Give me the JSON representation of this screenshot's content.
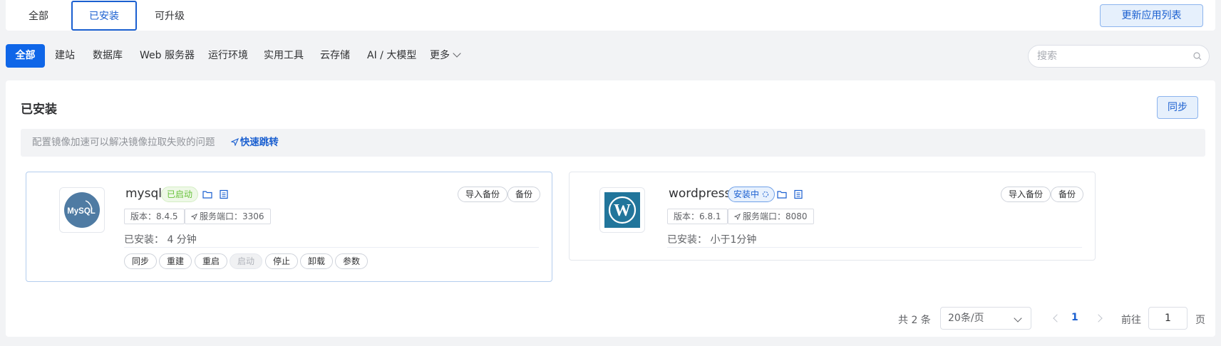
{
  "top_tabs": [
    {
      "label": "全部"
    },
    {
      "label": "已安装",
      "active": true
    },
    {
      "label": "可升级"
    }
  ],
  "refresh_label": "更新应用列表",
  "categories": [
    {
      "label": "全部",
      "active": true
    },
    {
      "label": "建站"
    },
    {
      "label": "数据库"
    },
    {
      "label": "Web 服务器"
    },
    {
      "label": "运行环境"
    },
    {
      "label": "实用工具"
    },
    {
      "label": "云存储"
    },
    {
      "label": "AI / 大模型"
    },
    {
      "label": "更多"
    }
  ],
  "search": {
    "placeholder": "搜索",
    "value": ""
  },
  "panel": {
    "title": "已安装",
    "sync_label": "同步",
    "notice_text": "配置镜像加速可以解决镜像拉取失败的问题",
    "notice_link": "快速跳转"
  },
  "apps": [
    {
      "name": "mysql",
      "logo_text": "MySQL",
      "status": "已启动",
      "version": "版本：8.4.5",
      "port": "服务端口：3306",
      "installed": "已安装： 4 分钟",
      "import_backup": "导入备份",
      "backup": "备份",
      "actions": [
        "同步",
        "重建",
        "重启",
        "启动",
        "停止",
        "卸载",
        "参数"
      ],
      "disabled_action": "启动"
    },
    {
      "name": "wordpress",
      "logo_text": "W",
      "status": "安装中",
      "version": "版本：6.8.1",
      "port": "服务端口：8080",
      "installed": "已安装： 小于1分钟",
      "import_backup": "导入备份",
      "backup": "备份"
    }
  ],
  "pagination": {
    "total": "共 2 条",
    "page_size": "20条/页",
    "current": "1",
    "goto_label": "前往",
    "goto_value": "1",
    "page_suffix": "页"
  },
  "colors": {
    "accent": "#1a5fd0",
    "primary_fill": "#0f66e8",
    "running_green": "#67c23a",
    "mysql_logo": "#4f7ba3",
    "wordpress_logo": "#21759b"
  },
  "icons": [
    "folder-icon",
    "document-icon",
    "search-icon",
    "send-icon",
    "chevron-down-icon",
    "spinner-icon"
  ]
}
